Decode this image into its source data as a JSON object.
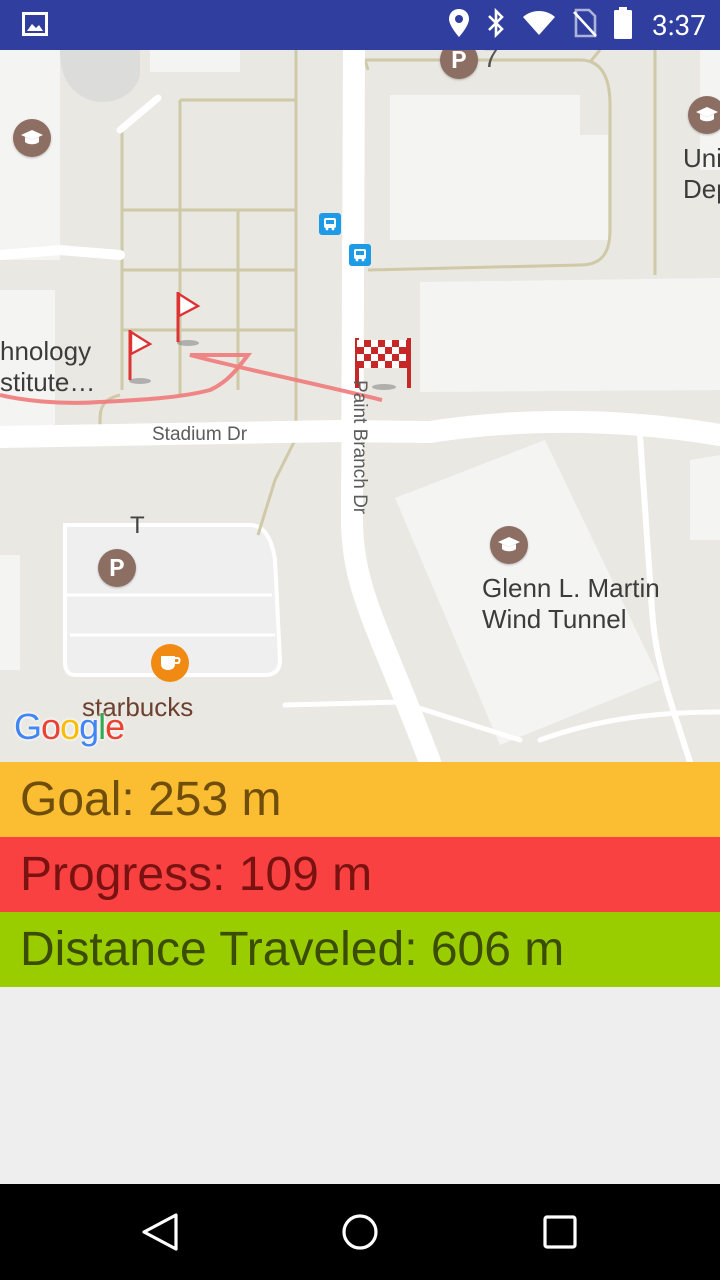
{
  "status_bar": {
    "time": "3:37",
    "icons": [
      "image-icon",
      "location-icon",
      "bluetooth-icon",
      "wifi-icon",
      "no-sim-icon",
      "battery-icon"
    ]
  },
  "map": {
    "labels": {
      "tech_institute_line1": "hnology",
      "tech_institute_line2": "stitute…",
      "stadium_dr": "Stadium Dr",
      "paint_branch_dr": "Paint Branch Dr",
      "glenn_martin_line1": "Glenn L. Martin",
      "glenn_martin_line2": "Wind Tunnel",
      "starbucks": "starbucks",
      "uni_line1": "Uni",
      "uni_line2": "Dep",
      "parking_top_number": "7",
      "parking_left_letter": "T",
      "parking_letter": "P"
    },
    "logo": "Google"
  },
  "stats": {
    "goal": "Goal: 253 m",
    "progress": "Progress: 109 m",
    "distance_traveled": "Distance Traveled: 606 m"
  },
  "colors": {
    "status_bar": "#303f9f",
    "goal": "#fbbd31",
    "progress": "#fa4141",
    "traveled": "#99cd00"
  }
}
